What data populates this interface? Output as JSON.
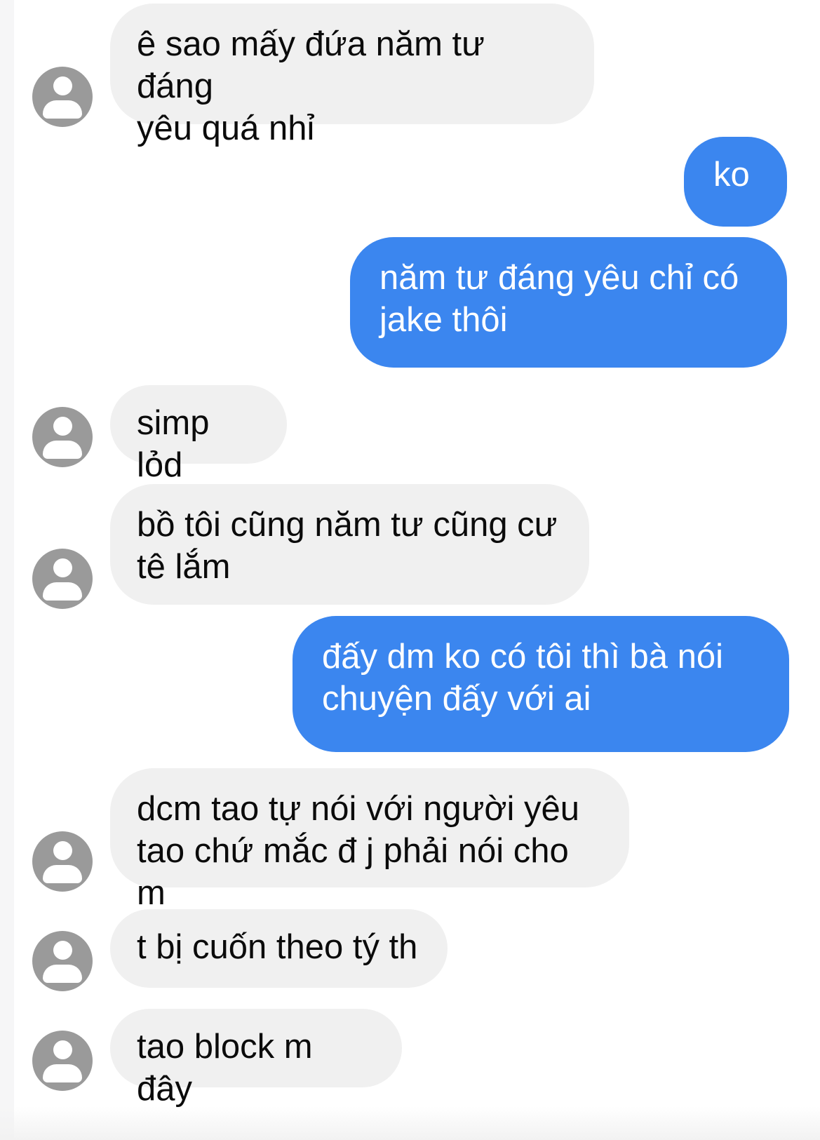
{
  "messages": [
    {
      "id": "m1",
      "side": "incoming",
      "avatar_icon": "user-avatar-icon",
      "text": "ê sao mấy đứa năm tư đáng\nyêu quá nhỉ"
    },
    {
      "id": "m2",
      "side": "outgoing",
      "text": "ko"
    },
    {
      "id": "m3",
      "side": "outgoing",
      "text": "năm tư đáng yêu chỉ có\njake thôi"
    },
    {
      "id": "m4",
      "side": "incoming",
      "avatar_icon": "user-avatar-icon",
      "text": "simp lỏd"
    },
    {
      "id": "m5",
      "side": "incoming",
      "avatar_icon": "user-avatar-icon",
      "text": "bồ tôi cũng năm tư cũng cư\ntê lắm"
    },
    {
      "id": "m6",
      "side": "outgoing",
      "text": "đấy dm ko có tôi thì bà nói\nchuyện đấy với ai"
    },
    {
      "id": "m7",
      "side": "incoming",
      "avatar_icon": "user-avatar-icon",
      "text": "dcm tao tự nói với người yêu\ntao chứ mắc đ j phải nói cho m"
    },
    {
      "id": "m8",
      "side": "incoming",
      "avatar_icon": "user-avatar-icon",
      "text": "t bị cuốn theo tý th"
    },
    {
      "id": "m9",
      "side": "incoming",
      "avatar_icon": "user-avatar-icon",
      "text": "tao block m đây"
    }
  ],
  "colors": {
    "incoming_bubble": "#f0f0f0",
    "incoming_text": "#0b0b0b",
    "outgoing_bubble": "#3b86ef",
    "outgoing_text": "#ffffff",
    "avatar_placeholder": "#9a9a9a"
  }
}
